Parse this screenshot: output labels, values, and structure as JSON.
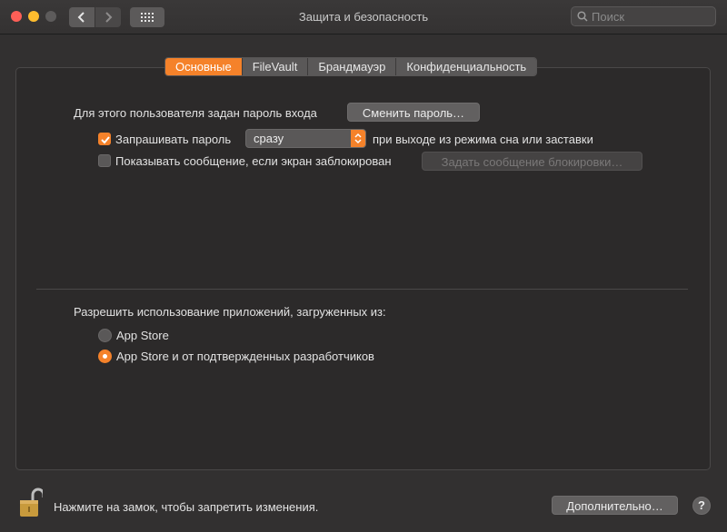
{
  "window": {
    "title": "Защита и безопасность",
    "search_placeholder": "Поиск"
  },
  "tabs": [
    {
      "label": "Основные",
      "active": true
    },
    {
      "label": "FileVault",
      "active": false
    },
    {
      "label": "Брандмауэр",
      "active": false
    },
    {
      "label": "Конфиденциальность",
      "active": false
    }
  ],
  "general": {
    "password_set_text": "Для этого пользователя задан пароль входа",
    "change_password_button": "Сменить пароль…",
    "require_password_label": "Запрашивать пароль",
    "require_password_checked": true,
    "require_password_delay": "сразу",
    "require_password_suffix": "при выходе из режима сна или заставки",
    "show_message_label": "Показывать сообщение, если экран заблокирован",
    "show_message_checked": false,
    "set_lock_message_button": "Задать сообщение блокировки…"
  },
  "apps": {
    "heading": "Разрешить использование приложений, загруженных из:",
    "options": [
      {
        "label": "App Store",
        "selected": false
      },
      {
        "label": "App Store и от подтвержденных разработчиков",
        "selected": true
      }
    ]
  },
  "footer": {
    "lock_text": "Нажмите на замок, чтобы запретить изменения.",
    "advanced_button": "Дополнительно…",
    "help_label": "?"
  },
  "colors": {
    "accent": "#f5822a",
    "background": "#323030",
    "panel": "#2c2a2a"
  }
}
